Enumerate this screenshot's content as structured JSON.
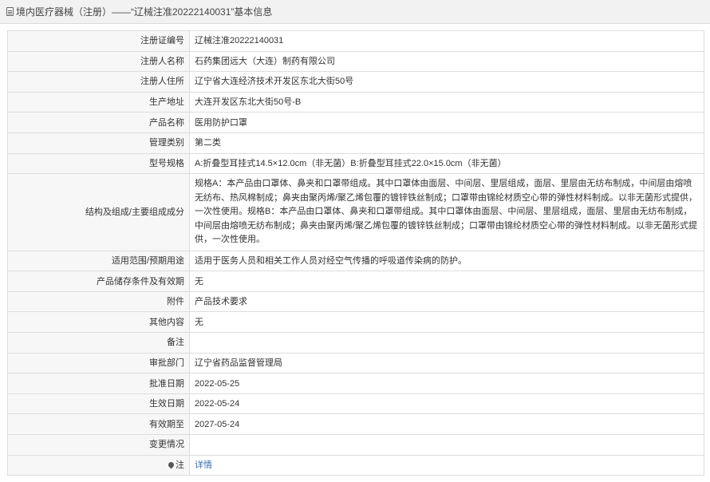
{
  "header": {
    "icon": "document-icon",
    "title": "境内医疗器械（注册）——“辽械注准20222140031”基本信息"
  },
  "rows": [
    {
      "label": "注册证编号",
      "value": "辽械注准20222140031"
    },
    {
      "label": "注册人名称",
      "value": "石药集团远大（大连）制药有限公司"
    },
    {
      "label": "注册人住所",
      "value": "辽宁省大连经济技术开发区东北大街50号"
    },
    {
      "label": "生产地址",
      "value": "大连开发区东北大街50号-B"
    },
    {
      "label": "产品名称",
      "value": "医用防护口罩"
    },
    {
      "label": "管理类别",
      "value": "第二类"
    },
    {
      "label": "型号规格",
      "value": "A:折叠型耳挂式14.5×12.0cm（非无菌）B:折叠型耳挂式22.0×15.0cm（非无菌）"
    },
    {
      "label": "结构及组成/主要组成成分",
      "value": "规格A：本产品由口罩体、鼻夹和口罩带组成。其中口罩体由面层、中间层、里层组成，面层、里层由无纺布制成，中间层由熔喷无纺布、热风棉制成；鼻夹由聚丙烯/聚乙烯包覆的镀锌铁丝制成；口罩带由锦纶材质空心带的弹性材料制成。以非无菌形式提供，一次性使用。规格B：本产品由口罩体、鼻夹和口罩带组成。其中口罩体由面层、中间层、里层组成，面层、里层由无纺布制成，中间层由熔喷无纺布制成；鼻夹由聚丙烯/聚乙烯包覆的镀锌铁丝制成；口罩带由锦纶材质空心带的弹性材料制成。以非无菌形式提供，一次性使用。"
    },
    {
      "label": "适用范围/预期用途",
      "value": "适用于医务人员和相关工作人员对经空气传播的呼吸道传染病的防护。"
    },
    {
      "label": "产品储存条件及有效期",
      "value": "无"
    },
    {
      "label": "附件",
      "value": "产品技术要求"
    },
    {
      "label": "其他内容",
      "value": "无"
    },
    {
      "label": "备注",
      "value": ""
    },
    {
      "label": "审批部门",
      "value": "辽宁省药品监督管理局"
    },
    {
      "label": "批准日期",
      "value": "2022-05-25"
    },
    {
      "label": "生效日期",
      "value": "2022-05-24"
    },
    {
      "label": "有效期至",
      "value": "2027-05-24"
    },
    {
      "label": "变更情况",
      "value": ""
    }
  ],
  "note": {
    "icon": "pin-icon",
    "label": "注",
    "link_text": "详情",
    "link_color": "#3a6fb0"
  }
}
